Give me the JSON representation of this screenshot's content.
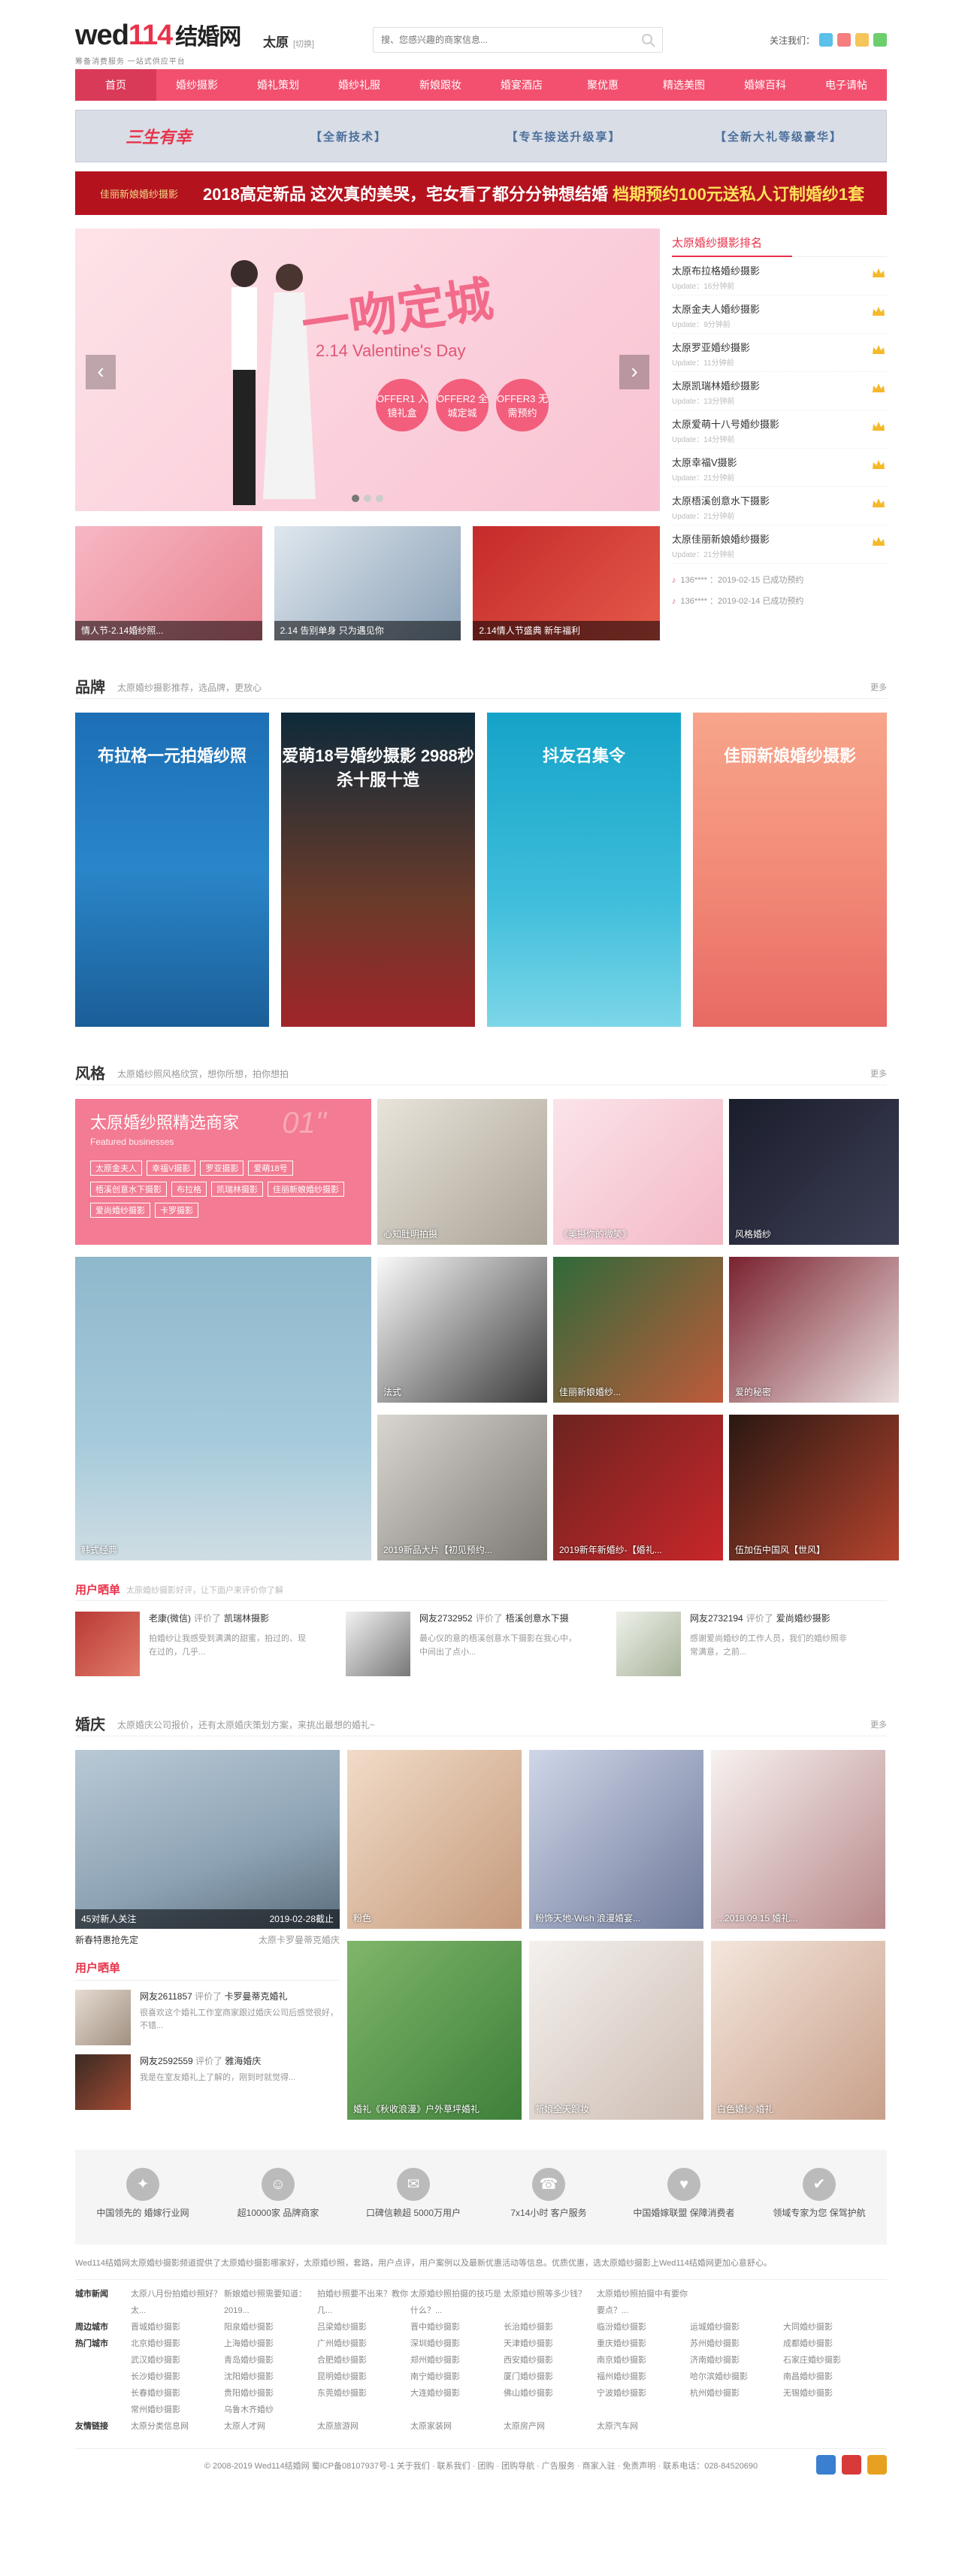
{
  "header": {
    "logo_text": "wed",
    "logo_num": "114",
    "logo_cn": "结婚网",
    "logo_slogan": "筹备消费服务 一站式供应平台",
    "city": "太原",
    "city_switch": "[切换]",
    "search_placeholder": "搜、您感兴趣的商家信息...",
    "follow_label": "关注我们："
  },
  "nav": [
    "首页",
    "婚纱摄影",
    "婚礼策划",
    "婚纱礼服",
    "新娘跟妆",
    "婚宴酒店",
    "聚优惠",
    "精选美图",
    "婚嫁百科",
    "电子请帖"
  ],
  "ad1": {
    "logo": "三生有幸",
    "segments": [
      "【全新技术】",
      "【专车接送升级享】",
      "【全新大礼等级豪华】"
    ]
  },
  "ad2": {
    "logo": "佳丽新娘婚纱摄影",
    "text_a": "2018高定新品  这次真的美哭，宅女看了都分分钟想结婚  ",
    "text_b": "档期预约100元送私人订制婚纱1套"
  },
  "slider": {
    "title": "一吻定城",
    "sub": "2.14 Valentine's Day",
    "badges": [
      "OFFER1 入镜礼盒",
      "OFFER2 全城定城",
      "OFFER3 无需预约"
    ]
  },
  "thumbs": [
    "情人节-2.14婚纱照...",
    "2.14 告别单身 只为遇见你",
    "2.14情人节盛典 新年福利"
  ],
  "rank": {
    "title": "太原婚纱摄影排名",
    "items": [
      {
        "name": "太原布拉格婚纱摄影",
        "upd": "Update：16分钟前"
      },
      {
        "name": "太原金夫人婚纱摄影",
        "upd": "Update：9分钟前"
      },
      {
        "name": "太原罗亚婚纱摄影",
        "upd": "Update：11分钟前"
      },
      {
        "name": "太原凯瑞林婚纱摄影",
        "upd": "Update：13分钟前"
      },
      {
        "name": "太原爱萌十八号婚纱摄影",
        "upd": "Update：14分钟前"
      },
      {
        "name": "太原幸福V摄影",
        "upd": "Update：21分钟前"
      },
      {
        "name": "太原梧溪创意水下摄影",
        "upd": "Update：21分钟前"
      },
      {
        "name": "太原佳丽新娘婚纱摄影",
        "upd": "Update：21分钟前"
      }
    ],
    "bookings": [
      "136**** ：2019-02-15 已成功预约",
      "136**** ：2019-02-14 已成功预约"
    ]
  },
  "brand": {
    "title": "品牌",
    "desc": "太原婚纱摄影推荐，选品牌，更放心",
    "more": "更多",
    "cards": [
      "布拉格一元拍婚纱照",
      "爱萌18号婚纱摄影 2988秒杀十服十造",
      "抖友召集令",
      "佳丽新娘婚纱摄影"
    ]
  },
  "style": {
    "title": "风格",
    "desc": "太原婚纱照风格欣赏，想你所想，拍你想拍",
    "more": "更多",
    "featured_title": "太原婚纱照精选商家",
    "featured_en": "Featured businesses",
    "featured_num": "01\"",
    "tags": [
      "太原金夫人",
      "幸福V摄影",
      "罗亚摄影",
      "爱萌18号",
      "梧溪创意水下摄影",
      "布拉格",
      "凯瑞林摄影",
      "佳丽新娘婚纱摄影",
      "爱尚婚纱摄影",
      "卡罗摄影"
    ],
    "featured_caption": "韩式经典",
    "items": [
      "心知肚明拍摄",
      "...",
      "《美摄你的微笑》",
      "风格婚纱",
      "法式",
      "佳丽新娘婚纱...",
      "爱的秘密",
      "2019新品大片【初见预约...",
      "2019新年新婚纱-【婚礼...",
      "伍加伍中国风【世风】"
    ]
  },
  "user_orders": {
    "title": "用户晒单",
    "desc": "太原婚纱摄影好评，让下面户来评价你了解",
    "items": [
      {
        "name": "老康(微信)",
        "verb": "评价了",
        "shop": "凯瑞林摄影",
        "text": "拍婚纱让我感受到满满的甜蜜，拍过的、现在过的，几乎..."
      },
      {
        "name": "网友2732952",
        "verb": "评价了",
        "shop": "梧溪创意水下摄",
        "text": "最心仪的意的梧溪创意水下摄影在我心中，中间出了点小..."
      },
      {
        "name": "网友2732194",
        "verb": "评价了",
        "shop": "爱尚婚纱摄影",
        "text": "感谢爱尚婚纱的工作人员，我们的婚纱照非常满意，之前..."
      }
    ]
  },
  "wedding": {
    "title": "婚庆",
    "desc": "太原婚庆公司报价，还有太原婚庆策划方案，来挑出最想的婚礼~",
    "more": "更多",
    "feature_caption": "45对新人关注",
    "feature_date": "2019-02-28截止",
    "meta_left": "新春特惠抢先定",
    "meta_right": "太原卡罗曼蒂克婚庆",
    "items": [
      "粉色",
      "粉饰天地-Wish 浪漫婚宴...",
      "...2018.09.15 婚礼...",
      "婚礼《秋收浪漫》户外草坪婚礼",
      "新娘全天跟妆",
      "白色婚纱 婚礼"
    ],
    "uo_title": "用户晒单",
    "uo": [
      {
        "name": "网友2611857",
        "verb": "评价了",
        "shop": "卡罗曼蒂克婚礼",
        "text": "很喜欢这个婚礼工作室商家跟过婚庆公司后感觉很好，不错..."
      },
      {
        "name": "网友2592559",
        "verb": "评价了",
        "shop": "雅海婚庆",
        "text": "我是在室友婚礼上了解的，刚到时就觉得..."
      }
    ]
  },
  "promises": [
    {
      "icon": "badge-icon",
      "text": "中国领先的 婚嫁行业网"
    },
    {
      "icon": "people-icon",
      "text": "超10000家 品牌商家"
    },
    {
      "icon": "chat-icon",
      "text": "口碑信赖超 5000万用户"
    },
    {
      "icon": "headset-icon",
      "text": "7x14小时 客户服务"
    },
    {
      "icon": "alliance-icon",
      "text": "中国婚嫁联盟 保障消费者"
    },
    {
      "icon": "shield-icon",
      "text": "领域专家为您 保驾护航"
    }
  ],
  "footer": {
    "intro": "Wed114结婚网太原婚纱摄影频道提供了太原婚纱摄影哪家好，太原婚纱照，套路，用户点评，用户案例以及最新优惠活动等信息。优质优惠，选太原婚纱摄影上Wed114结婚网更加心意舒心。",
    "link_rows": [
      {
        "label": "城市新闻",
        "items": [
          "太原八月份拍婚纱照好？太...",
          "新娘婚纱照需要知道：2019...",
          "拍婚纱照要不出来？教你几...",
          "太原婚纱照拍摄的技巧是什么？...",
          "太原婚纱照等多少钱？",
          "太原婚纱照拍摄中有要你要点？..."
        ]
      },
      {
        "label": "周边城市",
        "items": [
          "晋城婚纱摄影",
          "阳泉婚纱摄影",
          "吕梁婚纱摄影",
          "晋中婚纱摄影",
          "长治婚纱摄影",
          "临汾婚纱摄影",
          "运城婚纱摄影",
          "大同婚纱摄影"
        ]
      },
      {
        "label": "热门城市",
        "items": [
          "北京婚纱摄影",
          "上海婚纱摄影",
          "广州婚纱摄影",
          "深圳婚纱摄影",
          "天津婚纱摄影",
          "重庆婚纱摄影",
          "苏州婚纱摄影",
          "成都婚纱摄影",
          "武汉婚纱摄影",
          "青岛婚纱摄影",
          "合肥婚纱摄影",
          "郑州婚纱摄影",
          "西安婚纱摄影",
          "南京婚纱摄影",
          "济南婚纱摄影",
          "石家庄婚纱摄影",
          "长沙婚纱摄影",
          "沈阳婚纱摄影",
          "昆明婚纱摄影",
          "南宁婚纱摄影",
          "厦门婚纱摄影",
          "福州婚纱摄影",
          "哈尔滨婚纱摄影",
          "南昌婚纱摄影",
          "长春婚纱摄影",
          "贵阳婚纱摄影",
          "东莞婚纱摄影",
          "大连婚纱摄影",
          "佛山婚纱摄影",
          "宁波婚纱摄影",
          "杭州婚纱摄影",
          "无锡婚纱摄影",
          "常州婚纱摄影",
          "乌鲁木齐婚纱"
        ]
      },
      {
        "label": "友情链接",
        "items": [
          "太原分类信息网",
          "太原人才网",
          "太原旅游网",
          "太原家装网",
          "太原房产网",
          "太原汽车网"
        ]
      }
    ],
    "copyright": "© 2008-2019 Wed114结婚网  蜀ICP备08107937号-1    关于我们 · 联系我们 · 团购 · 团购导航 · 广告服务 · 商家入驻 · 免责声明 · 联系电话：028-84520690"
  }
}
